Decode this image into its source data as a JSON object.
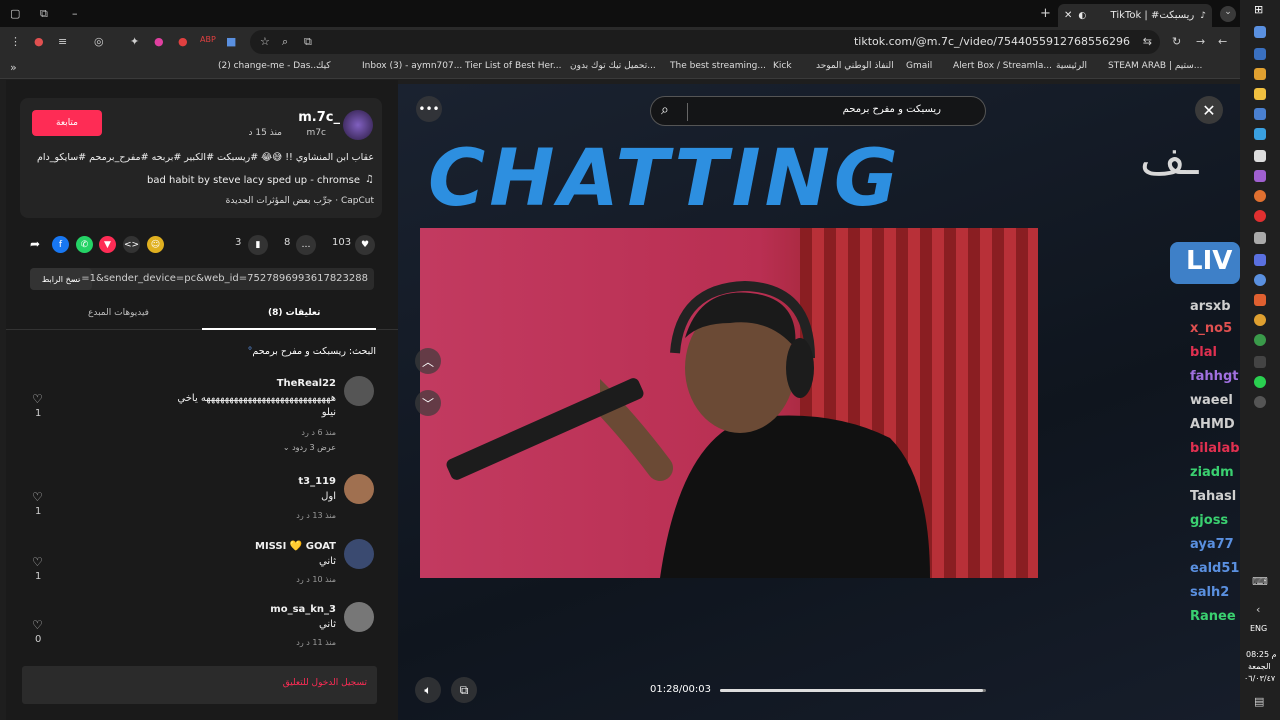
{
  "browser": {
    "tab_title": "ريسبكت# | TikTok",
    "url": "tiktok.com/@m.7c_/video/7544055912768556296",
    "bookmarks": [
      "(2) change-me - Das...",
      "كيك",
      "Inbox (3) - aymn707...",
      "Tier List of Best Her...",
      "تحميل تيك توك بدون...",
      "The best streaming...",
      "Kick",
      "النفاذ الوطني الموحد",
      "Gmail",
      "Alert Box / Streamla...",
      "الرئيسية",
      "STEAM ARAB | ستيم..."
    ]
  },
  "post": {
    "username": "m.7c_",
    "handle": "m7c",
    "posted": "منذ 15 د",
    "follow_label": "متابعة",
    "caption": "عقاب ابن المنشاوي !! 😅😂 #ريسبكت #الكبير #بربحه #مفرح_برمحم #سايكو_دام",
    "music": "bad habit by steve lacy sped up - chromse",
    "capcut": "CapCut · جرِّب بعض المؤثرات الجديدة",
    "likes": "103",
    "comments": "8",
    "saves": "3",
    "link": "...=1&sender_device=pc&web_id=7527896993617823288",
    "copy_label": "نسخ الرابط"
  },
  "tabs": {
    "comments": "تعليقات (8)",
    "creator_videos": "فيديوهات المبدع"
  },
  "search_hint": "البحث: ريسبكت و مفرح برمحم",
  "comments": [
    {
      "name": "TheReal22",
      "text": "ههههههههههههههههههههههههههههه ياخي",
      "text2": "نيلو",
      "meta": "منذ 6 د    رد",
      "likes": "1",
      "replies": "عرض 3 ردود"
    },
    {
      "name": "t3_119",
      "text": "اول",
      "meta": "منذ 13 د    رد",
      "likes": "1"
    },
    {
      "name": "MISSI 💛 GOAT",
      "text": "ثاني",
      "meta": "منذ 10 د    رد",
      "likes": "1"
    },
    {
      "name": "mo_sa_kn_3",
      "text": "ثاني",
      "meta": "منذ 11 د    رد",
      "likes": "0"
    }
  ],
  "login_label": "تسجيل الدخول للتعليق",
  "video": {
    "search_value": "ريسبكت و مفرح برمحم",
    "overlay_text": "CHATTING",
    "live_text": "LIV",
    "timecode": "01:28/00:03",
    "progress": 0.99,
    "chat_names": [
      {
        "n": "arsxb",
        "c": "#cfcfcf"
      },
      {
        "n": "x_no5",
        "c": "#e05050"
      },
      {
        "n": "blal",
        "c": "#e03050"
      },
      {
        "n": "fahhgt",
        "c": "#a070e0"
      },
      {
        "n": "waeel",
        "c": "#cfcfcf"
      },
      {
        "n": "AHMD",
        "c": "#cfcfcf"
      },
      {
        "n": "bilalab",
        "c": "#e03050"
      },
      {
        "n": "ziadm",
        "c": "#3ad070"
      },
      {
        "n": "Tahasl",
        "c": "#cfcfcf"
      },
      {
        "n": "gjoss",
        "c": "#3ad070"
      },
      {
        "n": "aya77",
        "c": "#5a90e0"
      },
      {
        "n": "eald51",
        "c": "#5a90e0"
      },
      {
        "n": "salh2",
        "c": "#5a90e0"
      },
      {
        "n": "Ranee",
        "c": "#3ad070"
      }
    ]
  },
  "taskbar": {
    "lang": "ENG",
    "time": "08:25 م",
    "day": "الجمعة",
    "date": "٠٦/٠٣/٤٧"
  }
}
